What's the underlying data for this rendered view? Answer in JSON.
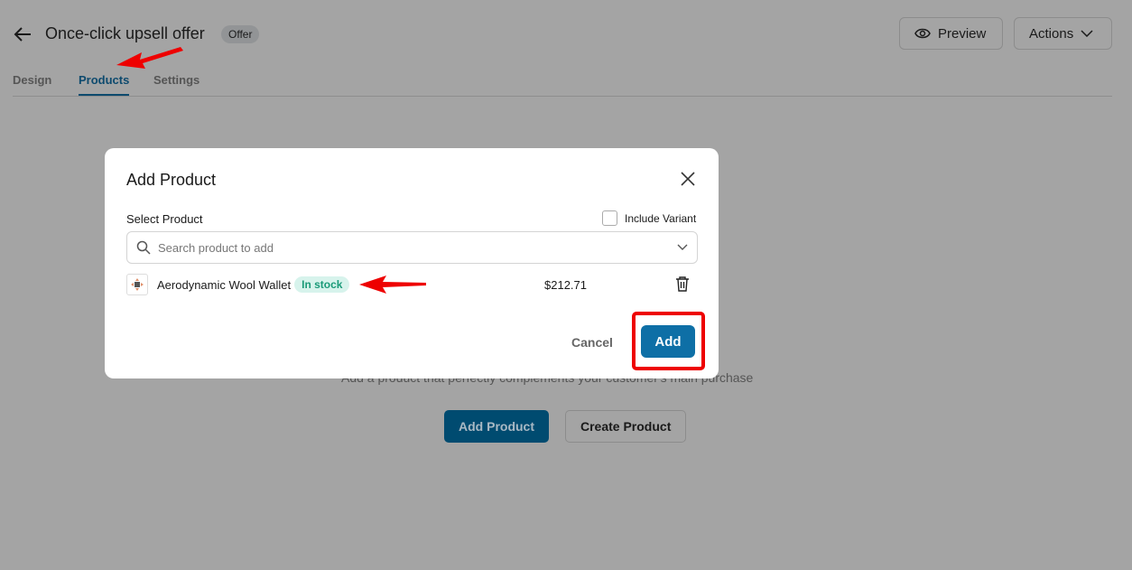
{
  "header": {
    "title": "Once-click upsell offer",
    "badge": "Offer",
    "preview_label": "Preview",
    "actions_label": "Actions"
  },
  "tabs": [
    {
      "label": "Design"
    },
    {
      "label": "Products",
      "active": true
    },
    {
      "label": "Settings"
    }
  ],
  "empty_state": {
    "description": "Add a product that perfectly complements your customer's main purchase",
    "add_product_label": "Add Product",
    "create_product_label": "Create Product"
  },
  "modal": {
    "title": "Add Product",
    "select_label": "Select Product",
    "include_variant_label": "Include Variant",
    "include_variant_checked": false,
    "search_placeholder": "Search product to add",
    "product": {
      "name": "Aerodynamic Wool Wallet",
      "stock": "In stock",
      "price": "$212.71"
    },
    "cancel_label": "Cancel",
    "add_label": "Add"
  },
  "colors": {
    "primary": "#0e6fa6",
    "annotation": "#ee0000",
    "stock_text": "#1a9a78"
  }
}
